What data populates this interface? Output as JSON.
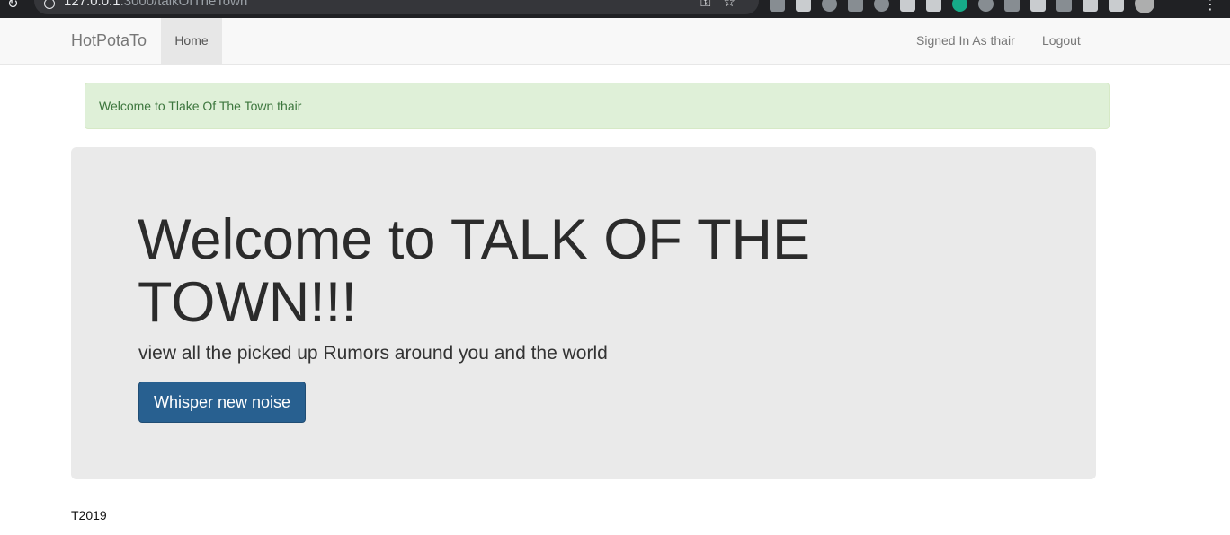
{
  "browser": {
    "url_host": "127.0.0.1",
    "url_rest": ":3000/talkOfTheTown"
  },
  "navbar": {
    "brand": "HotPotaTo",
    "home_label": "Home",
    "signed_in_label": "Signed In As thair",
    "logout_label": "Logout"
  },
  "alert": {
    "message": "Welcome to Tlake Of The Town thair"
  },
  "jumbotron": {
    "title": "Welcome to TALK OF THE TOWN!!!",
    "subtitle": "view all the picked up Rumors around you and the world",
    "button_label": "Whisper new noise"
  },
  "footer": {
    "text": "T2019"
  },
  "colors": {
    "alert_bg": "#dff0d8",
    "alert_text": "#3c763d",
    "primary_button": "#286090",
    "jumbotron_bg": "#eaeaea"
  }
}
